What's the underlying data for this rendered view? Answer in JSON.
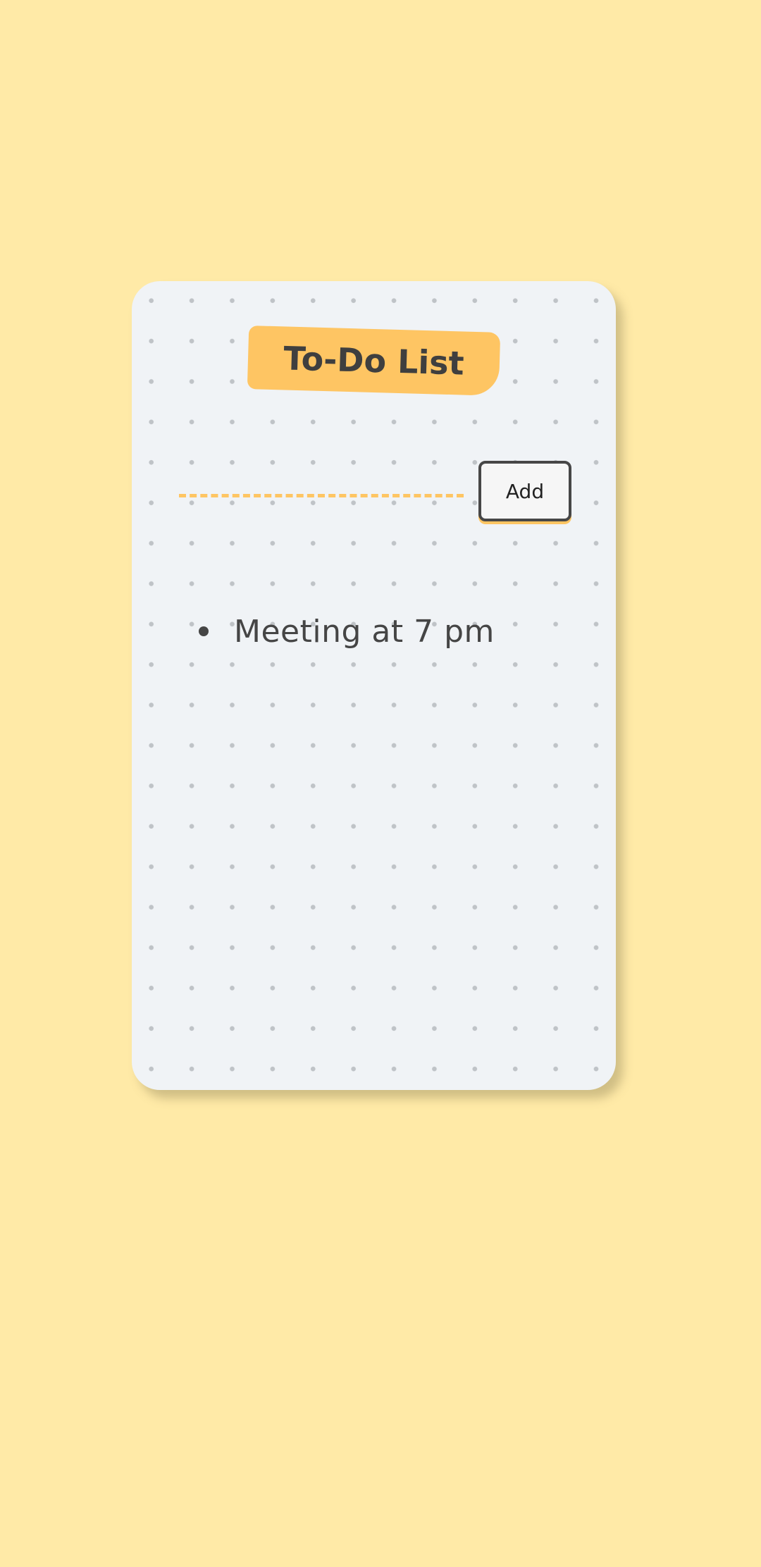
{
  "app": {
    "title": "To-Do List"
  },
  "form": {
    "input_value": "",
    "input_placeholder": "",
    "add_label": "Add"
  },
  "tasks": [
    {
      "text": "Meeting at 7 pm"
    }
  ],
  "colors": {
    "background": "#ffeaa7",
    "card": "#f0f3f6",
    "accent": "#fec563",
    "text": "#454545"
  }
}
